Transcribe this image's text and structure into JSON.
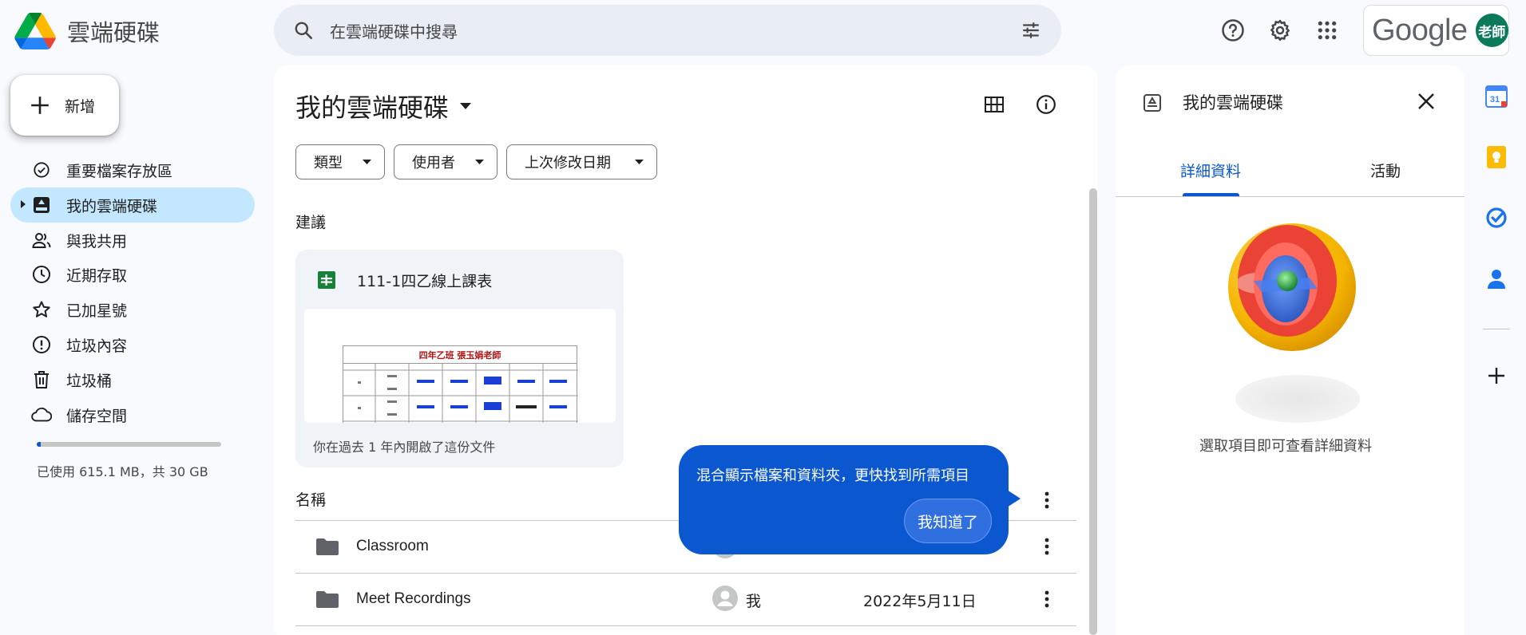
{
  "app": {
    "name": "雲端硬碟",
    "brand_colors": {
      "accent": "#0b57d0",
      "active_nav": "#c2e7ff",
      "surface": "#f8fafd"
    }
  },
  "header": {
    "search_placeholder": "在雲端硬碟中搜尋",
    "google_label": "Google",
    "avatar_text": "老師",
    "icons": [
      "search-icon",
      "search-options-icon",
      "help-icon",
      "settings-icon",
      "apps-icon"
    ]
  },
  "sidebar": {
    "new_label": "新增",
    "items": [
      {
        "label": "重要檔案存放區",
        "icon": "priority-icon"
      },
      {
        "label": "我的雲端硬碟",
        "icon": "my-drive-icon",
        "active": true
      },
      {
        "label": "與我共用",
        "icon": "shared-icon"
      },
      {
        "label": "近期存取",
        "icon": "clock-icon"
      },
      {
        "label": "已加星號",
        "icon": "star-icon"
      },
      {
        "label": "垃圾內容",
        "icon": "spam-icon"
      },
      {
        "label": "垃圾桶",
        "icon": "trash-icon"
      },
      {
        "label": "儲存空間",
        "icon": "cloud-icon"
      }
    ],
    "storage": {
      "text": "已使用 615.1 MB，共 30 GB",
      "used_fraction": 0.02
    }
  },
  "main": {
    "title": "我的雲端硬碟",
    "filters": [
      "類型",
      "使用者",
      "上次修改日期"
    ],
    "suggested_label": "建議",
    "suggested": {
      "title": "111-1四乙線上課表",
      "subtitle": "你在過去 1 年內開啟了這份文件",
      "preview_heading": "四年乙班 張玉娟老師"
    },
    "column_name": "名稱",
    "files": [
      {
        "name": "Classroom",
        "owner": "",
        "date": ""
      },
      {
        "name": "Meet Recordings",
        "owner": "我",
        "date": "2022年5月11日"
      }
    ]
  },
  "tooltip": {
    "text": "混合顯示檔案和資料夾，更快找到所需項目",
    "button": "我知道了"
  },
  "details": {
    "title": "我的雲端硬碟",
    "tabs": [
      "詳細資料",
      "活動"
    ],
    "hint": "選取項目即可查看詳細資料"
  }
}
